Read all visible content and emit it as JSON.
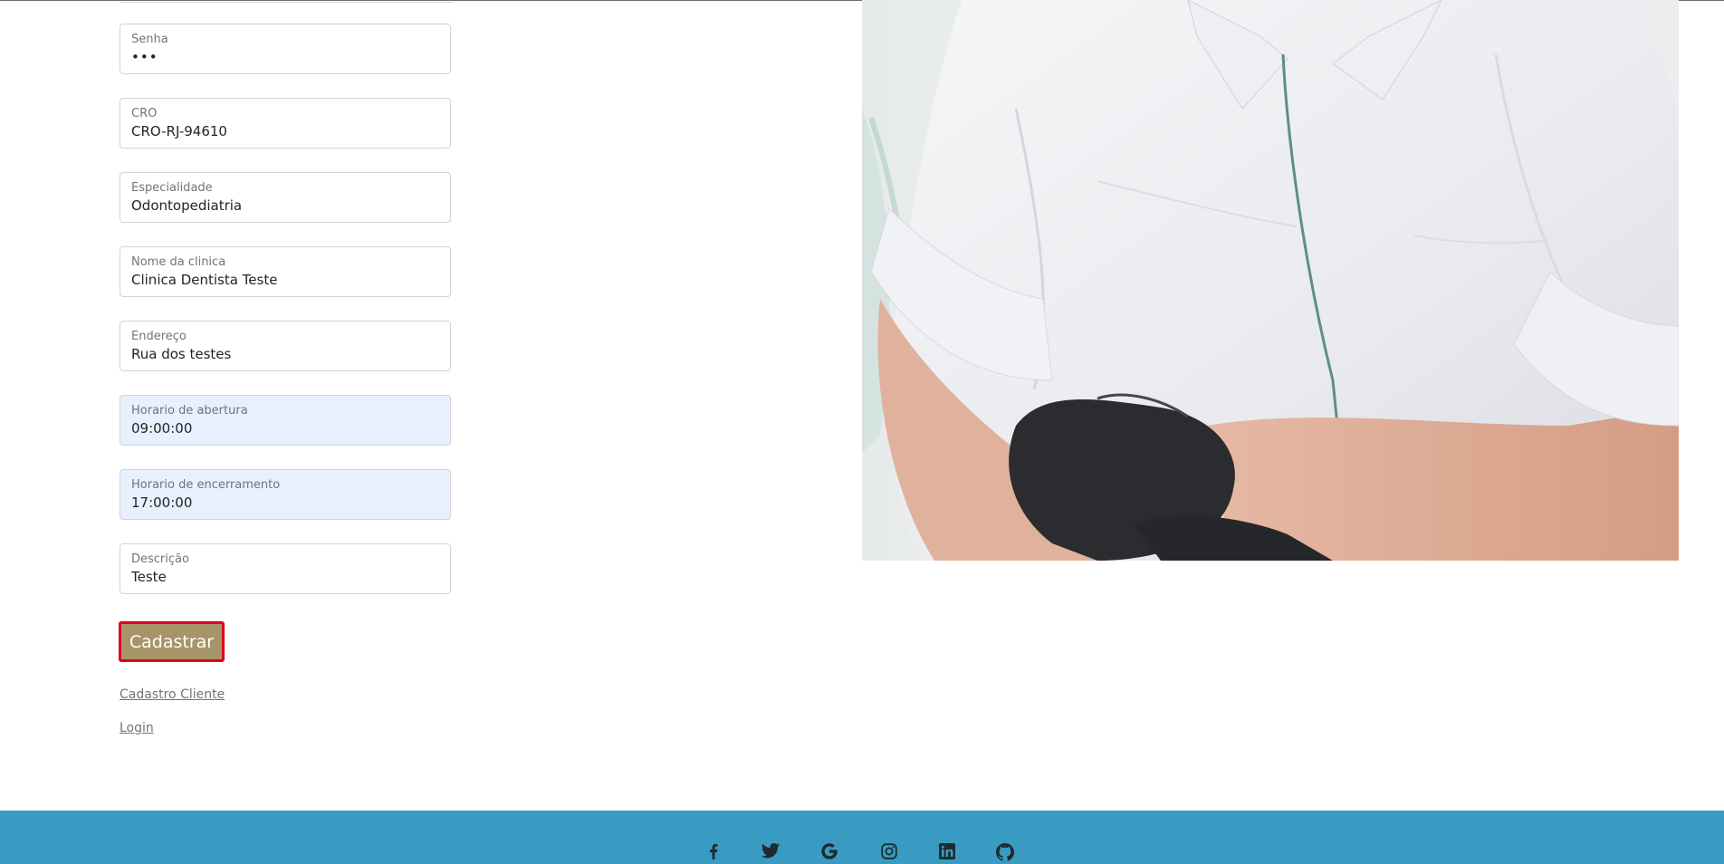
{
  "form": {
    "fields": [
      {
        "label": "Senha",
        "value": "•••"
      },
      {
        "label": "CRO",
        "value": "CRO-RJ-94610"
      },
      {
        "label": "Especialidade",
        "value": "Odontopediatria"
      },
      {
        "label": "Nome da clinica",
        "value": "Clinica Dentista Teste"
      },
      {
        "label": "Endereço",
        "value": "Rua dos testes"
      },
      {
        "label": "Horario de abertura",
        "value": "09:00:00"
      },
      {
        "label": "Horario de encerramento",
        "value": "17:00:00"
      },
      {
        "label": "Descrição",
        "value": "Teste"
      }
    ],
    "submit_label": "Cadastrar"
  },
  "links": {
    "cadastro_cliente": "Cadastro Cliente",
    "login": "Login"
  },
  "footer": {
    "background": "#3a9bc2",
    "social_icons": [
      "facebook-icon",
      "twitter-icon",
      "google-icon",
      "instagram-icon",
      "linkedin-icon",
      "github-icon"
    ]
  },
  "colors": {
    "button": "#a79468",
    "button_focus_border": "#e0001f",
    "autofill_bg": "#e8f0fe"
  }
}
